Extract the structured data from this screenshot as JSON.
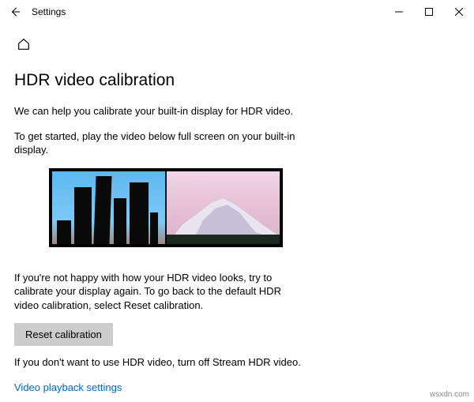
{
  "window": {
    "title": "Settings"
  },
  "page": {
    "heading": "HDR video calibration",
    "intro": "We can help you calibrate your built-in display for HDR video.",
    "instruction": "To get started, play the video below full screen on your built-in display.",
    "recalibrate_note": "If you're not happy with how your HDR video looks, try to calibrate your display again. To go back to the default HDR video calibration, select Reset calibration.",
    "reset_button": "Reset calibration",
    "turnoff_note": "If you don't want to use HDR video, turn off Stream HDR video.",
    "playback_link": "Video playback settings"
  },
  "watermark": "wsxdn.com"
}
